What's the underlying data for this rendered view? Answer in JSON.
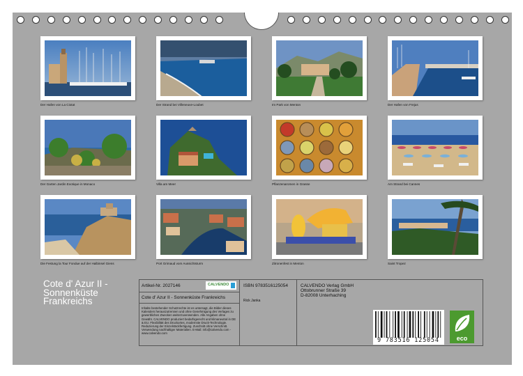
{
  "captions": [
    "Der Hafen von La Ciotat",
    "Der Strand bei Villeneuve-Loubet",
    "Im Park von Menton",
    "Der Hafen von Frejus",
    "Der Garten Jardin Exotique in Monaco",
    "Villa am Meer",
    "Pflanzenaromen in Grasse",
    "Am Strand bei Cannes",
    "Die Festung la Tour Fondue auf der Halbinsel Giens",
    "Port Grimaud vom Aussichtsturm",
    "Zitronenfest in Menton",
    "Saint Tropez"
  ],
  "title_lines": [
    "Cote d' Azur II -",
    "Sonnenküste",
    "Frankreichs"
  ],
  "info": {
    "article": "Artikel-Nr. 2027146",
    "title": "Cote d' Azur II - Sonnenküste Frankreichs",
    "isbn": "ISBN 9783516125054",
    "author": "Rick Janka",
    "publisher": [
      "CALVENDO Verlag GmbH",
      "Ottobrunner Straße 39",
      "D-82008 Unterhaching"
    ],
    "logo": "CALVENDO",
    "legal": "Inhalte bestehender Schutzrechte ist es untersagt, die Bilder dieses Kalenders herauszutrennen und ohne Genehmigung des Verlages zu gewerblichen Zwecken weiterzuverwenden. Alle Angaben ohne Gewähr. CALVENDO produziert bedarfsgerecht und klimaneutral in DE & EU. Flexibilität des Druckortes, modernste Druck-Technologie. Reduzierung der Einzelstückfertigung. Zuschnitt ohne Verschnitt. Verwendung nachhaltiger Materialien. E-Mail: info@calvendo.com - www.calvendo.com"
  },
  "barcode_digits": "9 783516 125054",
  "eco_label": "eco"
}
